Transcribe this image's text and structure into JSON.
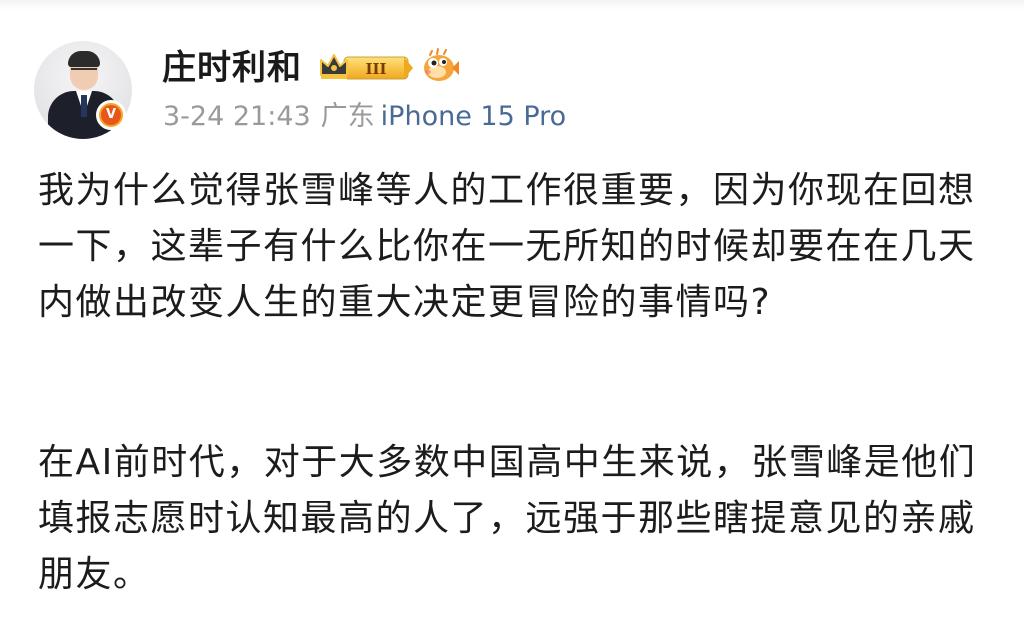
{
  "post": {
    "author": {
      "name": "庄时利和",
      "member_badge_level": "III",
      "verified_badge": "V",
      "avatar_icon": "avatar-photo",
      "extra_icon": "pufferfish-emoji-icon"
    },
    "meta": {
      "time": "3-24 21:43",
      "location": "广东",
      "device": "iPhone 15 Pro"
    },
    "paragraphs": [
      "我为什么觉得张雪峰等人的工作很重要，因为你现在回想一下，这辈子有什么比你在一无所知的时候却要在在几天内做出改变人生的重大决定更冒险的事情吗?",
      "在AI前时代，对于大多数中国高中生来说，张雪峰是他们填报志愿时认知最高的人了，远强于那些瞎提意见的亲戚朋友。"
    ]
  },
  "colors": {
    "device_link": "#4a6a95",
    "meta_text": "#9a9a9a",
    "badge_gold": "#f5a623",
    "verified_orange": "#e8561b"
  }
}
